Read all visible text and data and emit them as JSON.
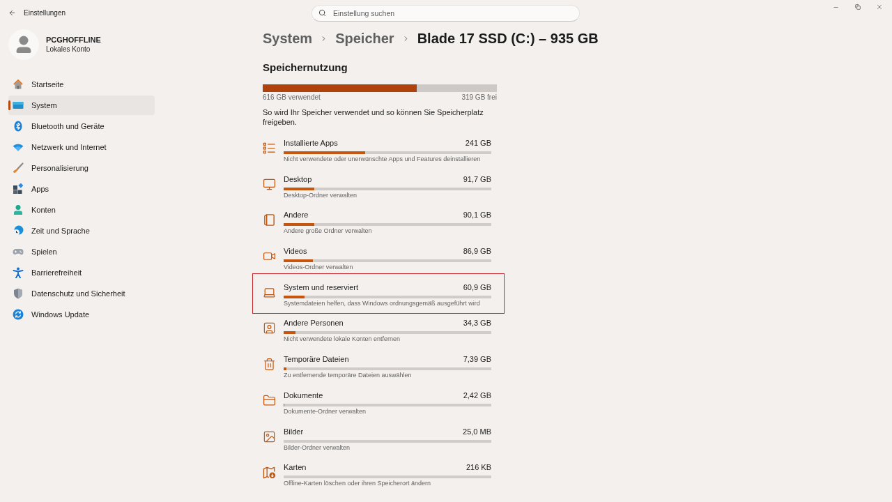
{
  "window": {
    "title": "Einstellungen"
  },
  "search": {
    "placeholder": "Einstellung suchen"
  },
  "account": {
    "name": "PCGHOFFLINE",
    "type": "Lokales Konto"
  },
  "sidebar": {
    "items": [
      {
        "label": "Startseite",
        "selected": false
      },
      {
        "label": "System",
        "selected": true
      },
      {
        "label": "Bluetooth und Geräte",
        "selected": false
      },
      {
        "label": "Netzwerk und Internet",
        "selected": false
      },
      {
        "label": "Personalisierung",
        "selected": false
      },
      {
        "label": "Apps",
        "selected": false
      },
      {
        "label": "Konten",
        "selected": false
      },
      {
        "label": "Zeit und Sprache",
        "selected": false
      },
      {
        "label": "Spielen",
        "selected": false
      },
      {
        "label": "Barrierefreiheit",
        "selected": false
      },
      {
        "label": "Datenschutz und Sicherheit",
        "selected": false
      },
      {
        "label": "Windows Update",
        "selected": false
      }
    ]
  },
  "breadcrumb": [
    "System",
    "Speicher",
    "Blade 17 SSD (C:) – 935 GB"
  ],
  "storage": {
    "title": "Speichernutzung",
    "level": 0.657,
    "used": "616 GB verwendet",
    "free": "319 GB frei",
    "description": "So wird Ihr Speicher verwendet und so können Sie Speicherplatz freigeben."
  },
  "categories": [
    {
      "name": "Installierte Apps",
      "size": "241 GB",
      "level": 0.391,
      "hint": "Nicht verwendete oder unerwünschte Apps und Features deinstallieren",
      "highlighted": false
    },
    {
      "name": "Desktop",
      "size": "91,7 GB",
      "level": 0.149,
      "hint": "Desktop-Ordner verwalten",
      "highlighted": false
    },
    {
      "name": "Andere",
      "size": "90,1 GB",
      "level": 0.146,
      "hint": "Andere große Ordner verwalten",
      "highlighted": false
    },
    {
      "name": "Videos",
      "size": "86,9 GB",
      "level": 0.141,
      "hint": "Videos-Ordner verwalten",
      "highlighted": false
    },
    {
      "name": "System und reserviert",
      "size": "60,9 GB",
      "level": 0.099,
      "hint": "Systemdateien helfen, dass Windows ordnungsgemäß ausgeführt wird",
      "highlighted": true
    },
    {
      "name": "Andere Personen",
      "size": "34,3 GB",
      "level": 0.056,
      "hint": "Nicht verwendete lokale Konten entfernen",
      "highlighted": false
    },
    {
      "name": "Temporäre Dateien",
      "size": "7,39 GB",
      "level": 0.012,
      "hint": "Zu entfernende temporäre Dateien auswählen",
      "highlighted": false
    },
    {
      "name": "Dokumente",
      "size": "2,42 GB",
      "level": 0.004,
      "hint": "Dokumente-Ordner verwalten",
      "highlighted": false
    },
    {
      "name": "Bilder",
      "size": "25,0 MB",
      "hint": "Bilder-Ordner verwalten",
      "highlighted": false
    },
    {
      "name": "Karten",
      "size": "216 KB",
      "hint": "Offline-Karten löschen oder ihren Speicherort ändern",
      "highlighted": false
    }
  ]
}
